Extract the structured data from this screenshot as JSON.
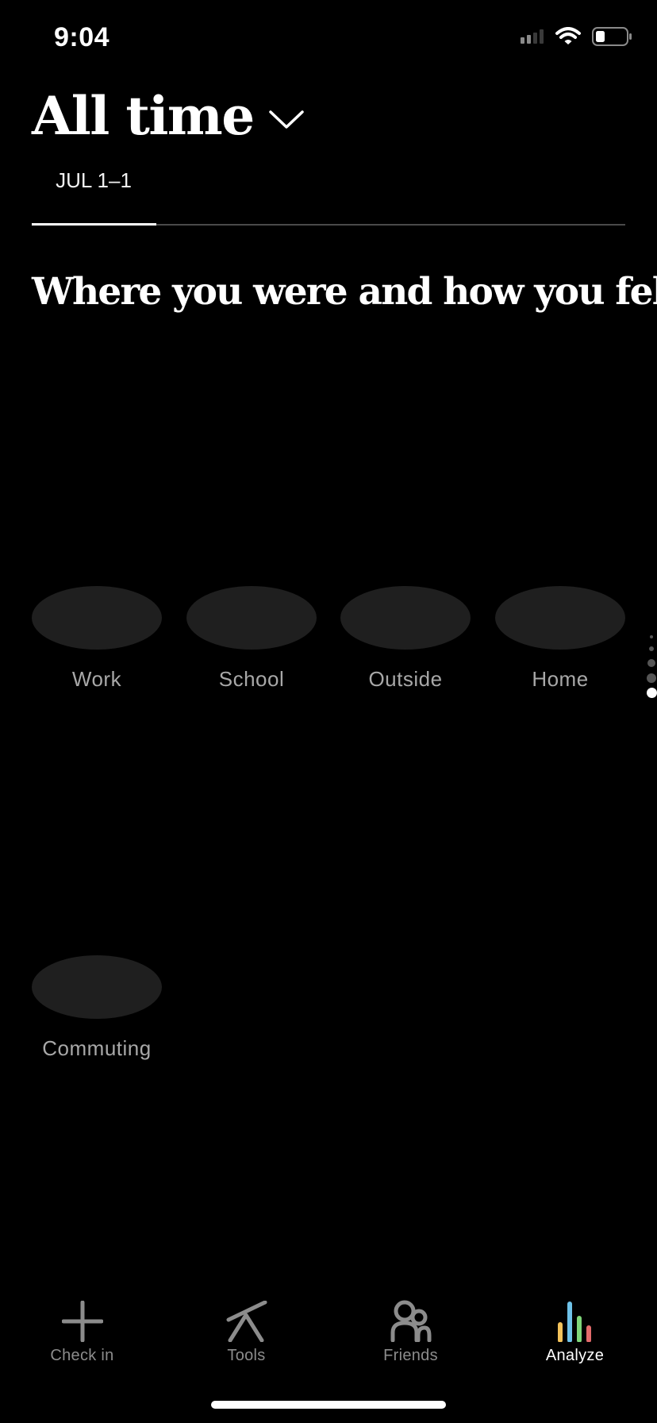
{
  "status_bar": {
    "time": "9:04",
    "icons": [
      "signal-icon",
      "wifi-icon",
      "battery-icon"
    ]
  },
  "header": {
    "title": "All time",
    "dropdown_icon": "chevron-down-icon"
  },
  "period_tabs": [
    {
      "label": "JUL 1–1",
      "selected": true
    }
  ],
  "section": {
    "title": "Where you were and how you felt"
  },
  "places": [
    {
      "label": "Work"
    },
    {
      "label": "School"
    },
    {
      "label": "Outside"
    },
    {
      "label": "Home"
    },
    {
      "label": "Commuting"
    }
  ],
  "pagination": {
    "count": 5,
    "active_index": 4
  },
  "tab_bar": {
    "items": [
      {
        "label": "Check in",
        "icon": "plus-icon",
        "active": false
      },
      {
        "label": "Tools",
        "icon": "tools-icon",
        "active": false
      },
      {
        "label": "Friends",
        "icon": "friends-icon",
        "active": false
      },
      {
        "label": "Analyze",
        "icon": "analyze-icon",
        "active": true
      }
    ]
  },
  "colors": {
    "background": "#000000",
    "blob": "#1f1f1f",
    "inactive_text": "#8c8c8c",
    "analyze_bars": [
      "#f3c25a",
      "#6fc2e8",
      "#7fd67a",
      "#e36b6b"
    ]
  }
}
